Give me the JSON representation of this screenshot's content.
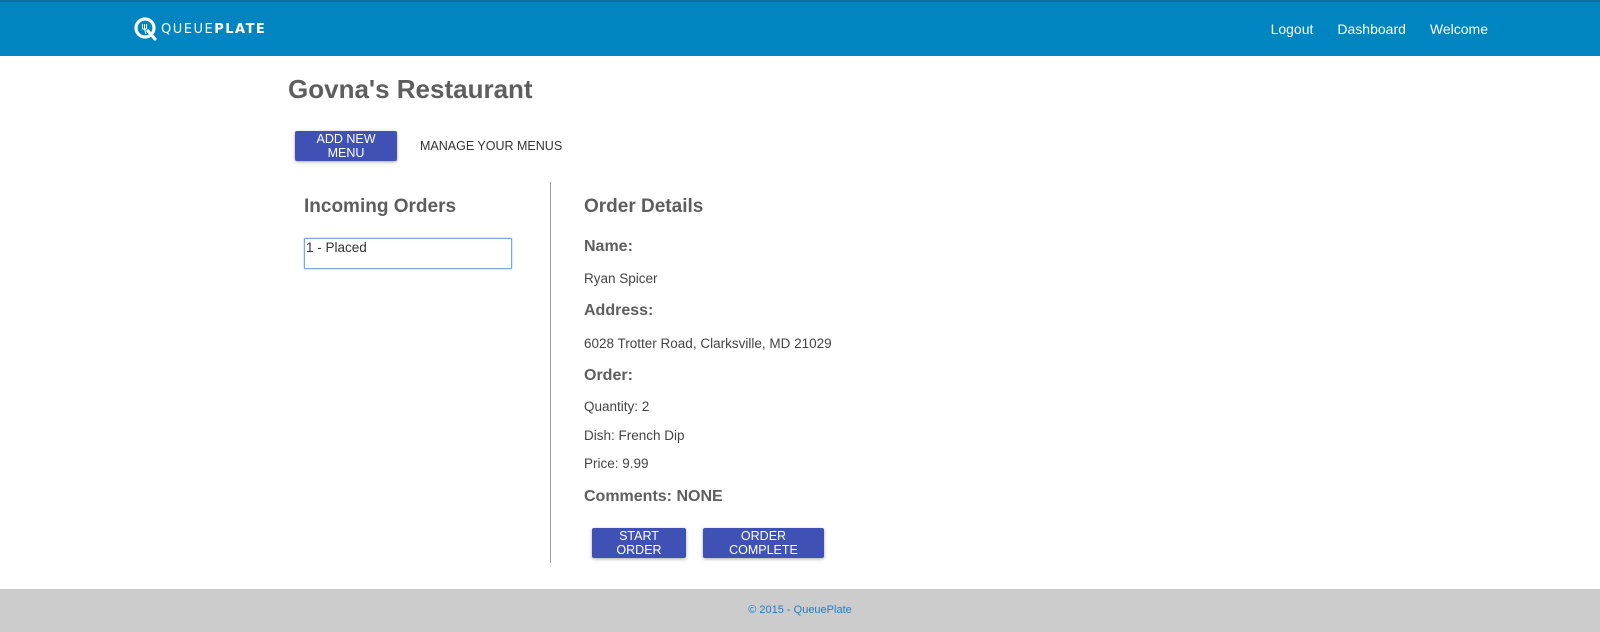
{
  "header": {
    "brand_light": "QUEUE",
    "brand_bold": "PLATE",
    "nav": {
      "logout": "Logout",
      "dashboard": "Dashboard",
      "welcome": "Welcome"
    },
    "bar_color": "#0085c0"
  },
  "restaurant": {
    "name": "Govna's Restaurant"
  },
  "toolbar": {
    "add_menu_label": "ADD NEW MENU",
    "manage_menus_label": "MANAGE YOUR MENUS"
  },
  "incoming": {
    "title": "Incoming Orders",
    "orders": [
      "1 - Placed"
    ]
  },
  "details": {
    "title": "Order Details",
    "name_label": "Name:",
    "name_value": "Ryan Spicer",
    "address_label": "Address:",
    "address_value": "6028 Trotter Road, Clarksville, MD 21029",
    "order_label": "Order:",
    "quantity": "Quantity: 2",
    "dish": "Dish: French Dip",
    "price": "Price: 9.99",
    "comments": "Comments: NONE"
  },
  "actions": {
    "start_label": "START ORDER",
    "complete_label": "ORDER COMPLETE",
    "accent": "#3f51b5"
  },
  "footer": {
    "text": "© 2015 - QueuePlate"
  }
}
